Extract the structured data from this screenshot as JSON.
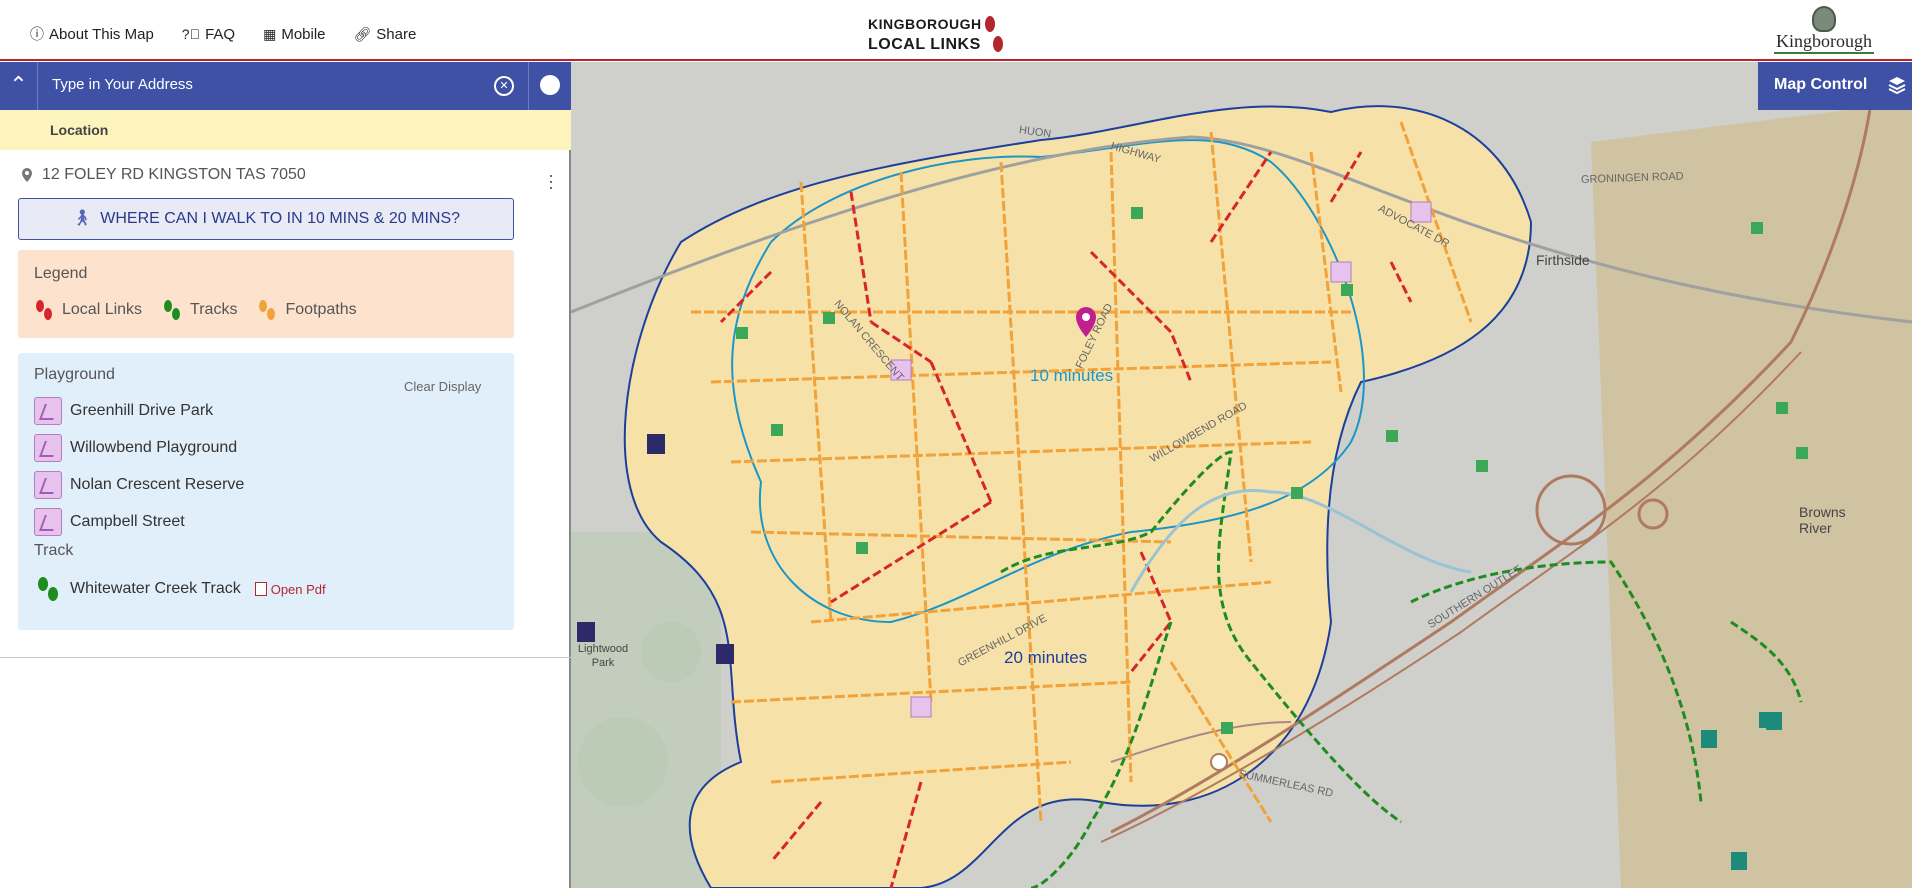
{
  "header": {
    "nav": [
      {
        "label": "About This Map",
        "icon": "info-circle-icon"
      },
      {
        "label": "FAQ",
        "icon": "question-circle-icon"
      },
      {
        "label": "Mobile",
        "icon": "qrcode-icon"
      },
      {
        "label": "Share",
        "icon": "link-icon"
      }
    ],
    "logo_line1": "KINGBOROUGH",
    "logo_line2": "LOCAL LINKS",
    "council_name": "Kingborough"
  },
  "search": {
    "placeholder": "Type in Your Address"
  },
  "location_label": "Location",
  "selected_address": "12 FOLEY RD KINGSTON TAS 7050",
  "walk_button": "WHERE CAN I WALK TO IN 10 MINS & 20 MINS?",
  "legend": {
    "title": "Legend",
    "items": [
      {
        "label": "Local Links",
        "color": "#d7262b"
      },
      {
        "label": "Tracks",
        "color": "#1e8c1e"
      },
      {
        "label": "Footpaths",
        "color": "#f2a23a"
      }
    ]
  },
  "results": {
    "playground_heading": "Playground",
    "clear_label": "Clear Display",
    "playgrounds": [
      "Greenhill Drive Park",
      "Willowbend Playground",
      "Nolan Crescent Reserve",
      "Campbell Street"
    ],
    "track_heading": "Track",
    "tracks": [
      {
        "name": "Whitewater Creek Track",
        "link": "Open Pdf"
      }
    ]
  },
  "map": {
    "control_label": "Map Control",
    "isochrone_10": "10 minutes",
    "isochrone_20": "20 minutes",
    "places": [
      "Firthside",
      "Browns River",
      "Lightwood Park"
    ],
    "roads": [
      "HUON",
      "HIGHWAY",
      "SOUTHERN OUTLET",
      "SUMMERLEAS RD",
      "WILLOWBEND ROAD",
      "FOLEY ROAD",
      "GREENHILL DRIVE",
      "NOLAN CRESCENT",
      "ADVOCATE DR",
      "GRONINGEN ROAD"
    ],
    "colors": {
      "isochrone_10": "#1b96c7",
      "isochrone_20": "#1b3f9c",
      "marker": "#c21f8e",
      "residential": "#f6e2a9"
    }
  }
}
